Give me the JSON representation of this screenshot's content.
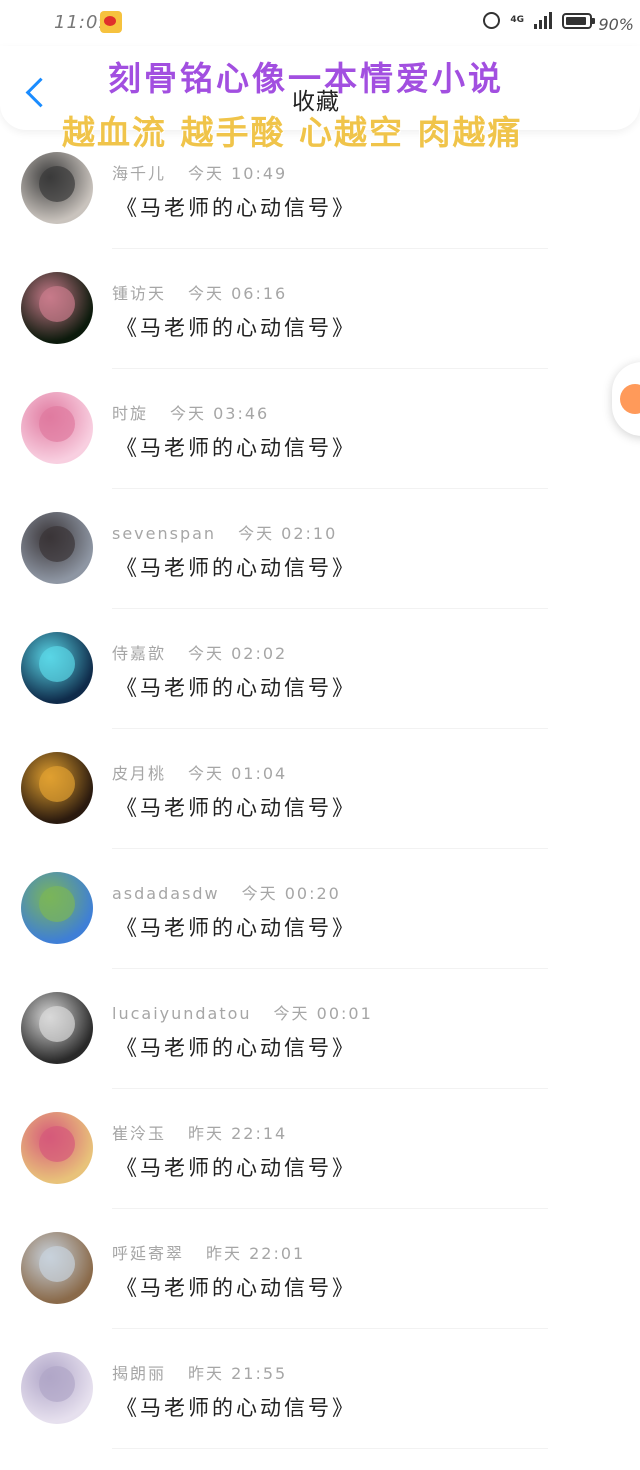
{
  "status_bar": {
    "time": "11:09",
    "network": "4G",
    "battery": "90%",
    "battery_level": 0.9
  },
  "header": {
    "title": "收藏",
    "back_icon": "chevron-left-icon"
  },
  "overlay": {
    "line1": "刻骨铭心像一本情爱小说",
    "line2": "越血流 越手酸 心越空 肉越痛"
  },
  "items": [
    {
      "name": "海千儿",
      "time": "今天 10:49",
      "text": "《马老师的心动信号》",
      "avatar_colors": [
        "#c9c3bd",
        "#3a3a3a"
      ]
    },
    {
      "name": "锺访天",
      "time": "今天 06:16",
      "text": "《马老师的心动信号》",
      "avatar_colors": [
        "#0c1a0c",
        "#c77a8a"
      ]
    },
    {
      "name": "时旋",
      "time": "今天 03:46",
      "text": "《马老师的心动信号》",
      "avatar_colors": [
        "#f8cfe0",
        "#e07aa0"
      ]
    },
    {
      "name": "sevenspan",
      "time": "今天 02:10",
      "text": "《马老师的心动信号》",
      "avatar_colors": [
        "#8e96a3",
        "#3a3538"
      ]
    },
    {
      "name": "侍嘉歆",
      "time": "今天 02:02",
      "text": "《马老师的心动信号》",
      "avatar_colors": [
        "#0f2b4a",
        "#5ad6e6"
      ]
    },
    {
      "name": "皮月桃",
      "time": "今天 01:04",
      "text": "《马老师的心动信号》",
      "avatar_colors": [
        "#2a1a0f",
        "#e0a030"
      ]
    },
    {
      "name": "asdadasdw",
      "time": "今天 00:20",
      "text": "《马老师的心动信号》",
      "avatar_colors": [
        "#3f7fd6",
        "#7ab55a"
      ]
    },
    {
      "name": "lucaiyundatou",
      "time": "今天 00:01",
      "text": "《马老师的心动信号》",
      "avatar_colors": [
        "#2a2a2a",
        "#d9d9d9"
      ]
    },
    {
      "name": "崔泠玉",
      "time": "昨天 22:14",
      "text": "《马老师的心动信号》",
      "avatar_colors": [
        "#e8c27a",
        "#d65a7a"
      ]
    },
    {
      "name": "呼延寄翠",
      "time": "昨天 22:01",
      "text": "《马老师的心动信号》",
      "avatar_colors": [
        "#8a6a4a",
        "#c8d2dc"
      ]
    },
    {
      "name": "揭朗丽",
      "time": "昨天 21:55",
      "text": "《马老师的心动信号》",
      "avatar_colors": [
        "#e6e0ee",
        "#b0a6c8"
      ]
    }
  ]
}
